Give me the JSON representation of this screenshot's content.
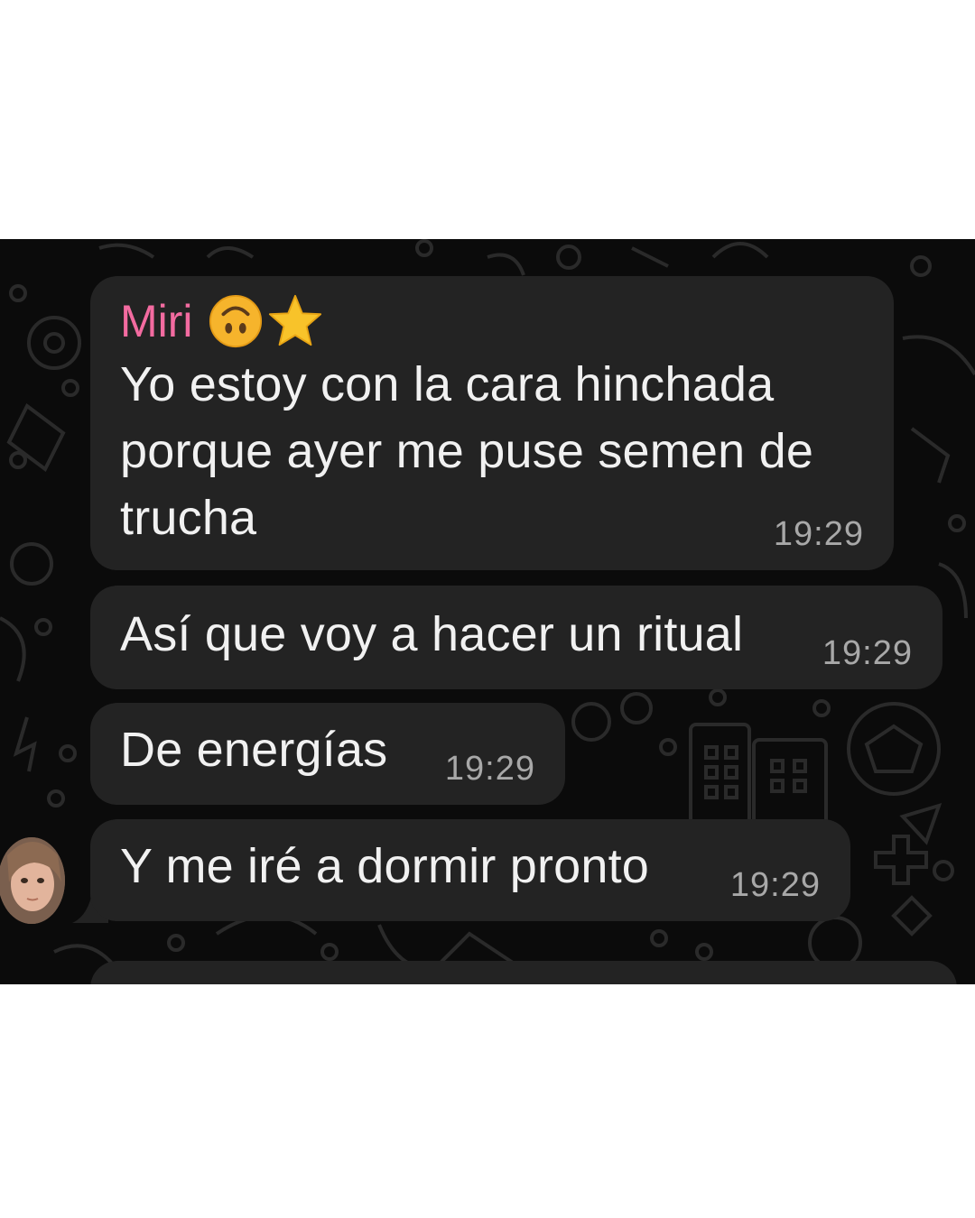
{
  "messages": [
    {
      "sender": "Miri",
      "sender_emojis": [
        "upside-down-face",
        "star"
      ],
      "lines": [
        "Yo estoy con la cara hinchada",
        "porque ayer me puse semen de",
        "trucha"
      ],
      "time": "19:29"
    },
    {
      "text": "Así que voy a hacer un ritual",
      "time": "19:29"
    },
    {
      "text": "De energías",
      "time": "19:29"
    },
    {
      "text": "Y me iré a dormir pronto",
      "time": "19:29"
    }
  ],
  "colors": {
    "chat_background": "#0b0b0b",
    "bubble": "#232323",
    "sender_name": "#f36ba0",
    "message_text": "#f1f1f1",
    "timestamp": "#a8a8a8"
  },
  "icons": [
    "upside-down-face-icon",
    "star-icon",
    "avatar"
  ]
}
